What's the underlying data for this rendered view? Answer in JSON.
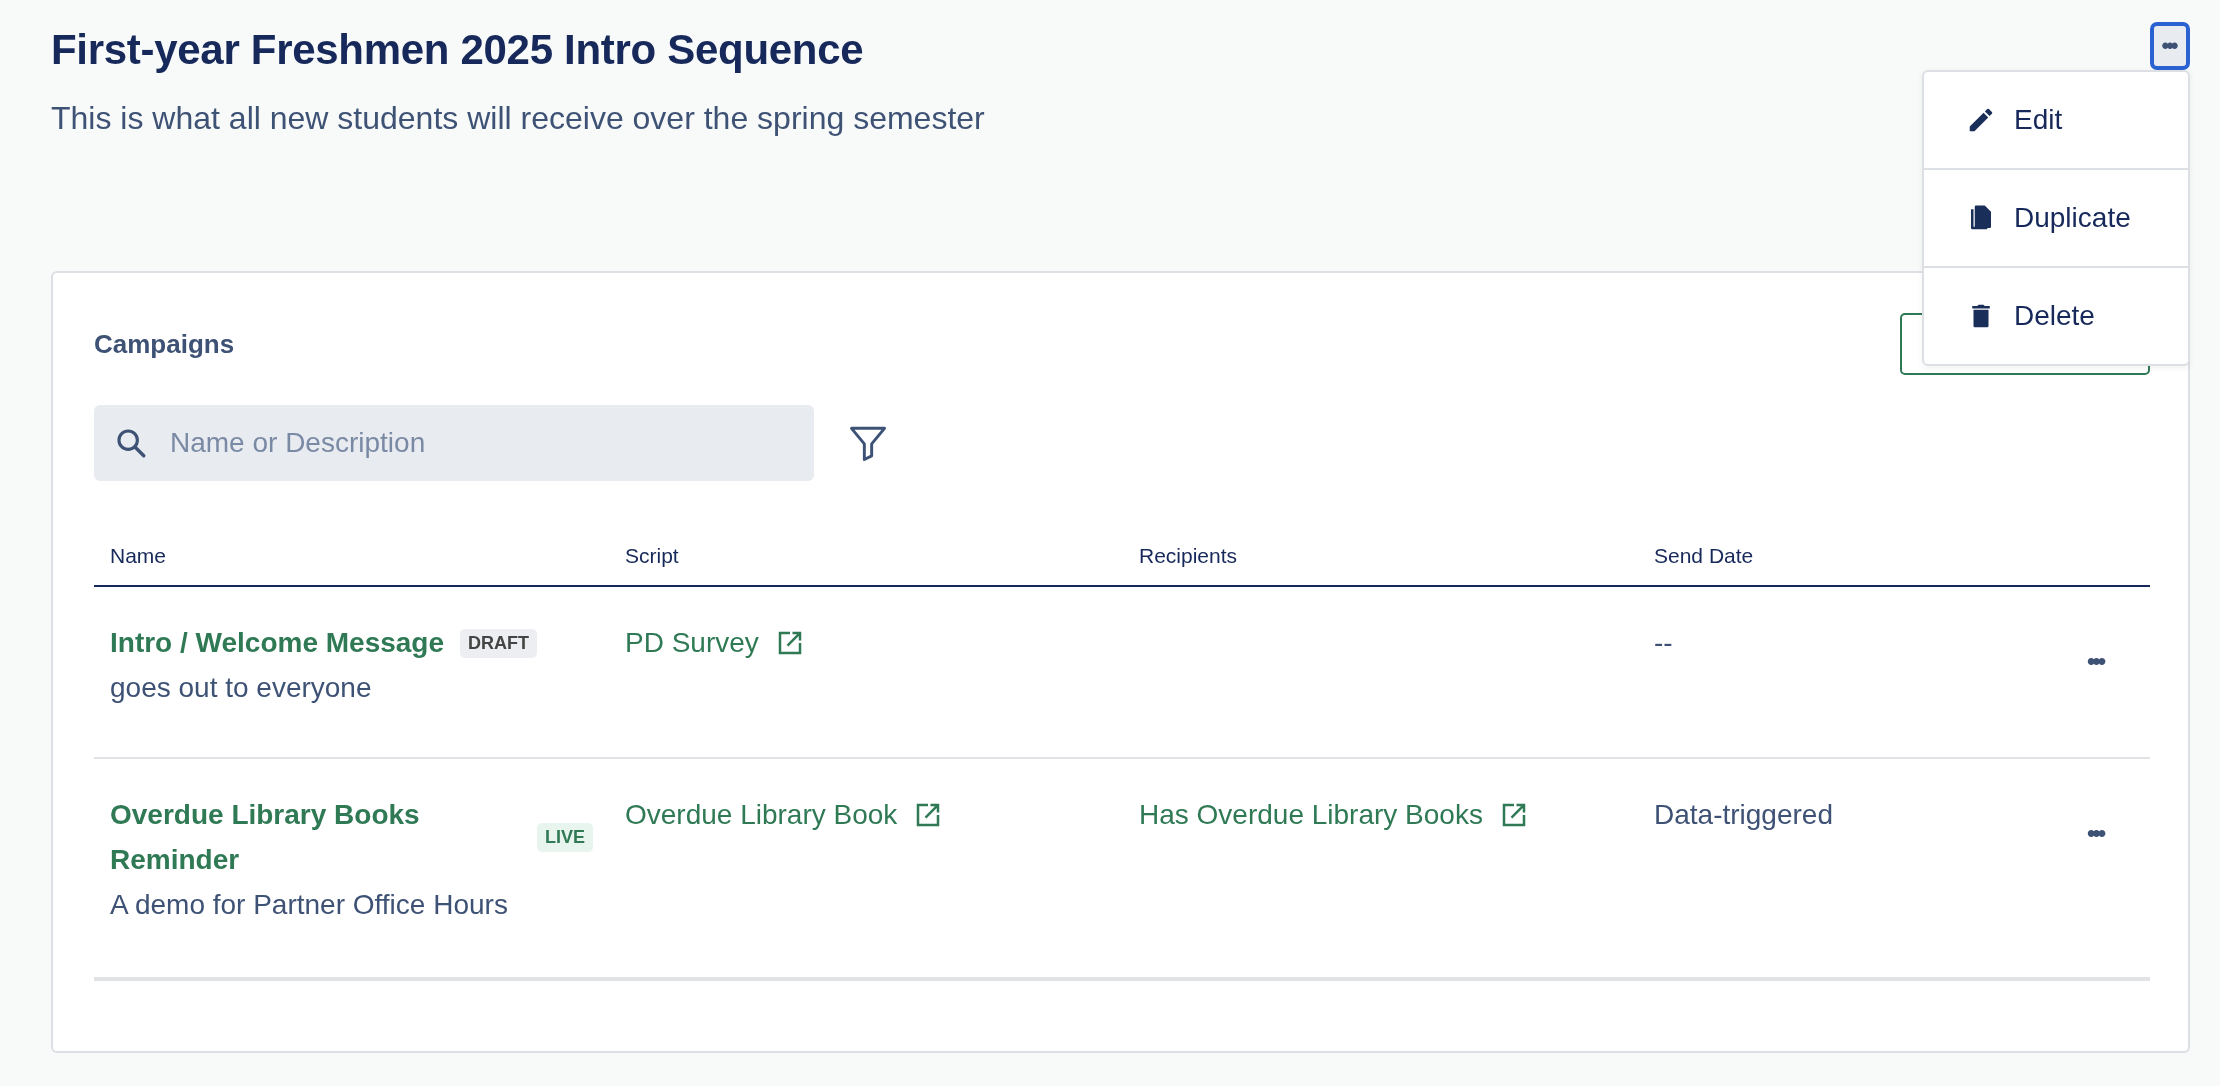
{
  "page": {
    "title": "First-year Freshmen 2025 Intro Sequence",
    "subtitle": "This is what all new students will receive over the spring semester",
    "more_button": {
      "label": "•••",
      "focused": true
    }
  },
  "menu": {
    "items": [
      {
        "label": "Edit",
        "kind": "edit"
      },
      {
        "label": "Duplicate",
        "kind": "duplicate"
      },
      {
        "label": "Delete",
        "kind": "delete"
      }
    ]
  },
  "campaigns": {
    "heading": "Campaigns",
    "search": {
      "placeholder": "Name or Description"
    },
    "table": {
      "columns": [
        "Name",
        "Script",
        "Recipients",
        "Send Date"
      ],
      "rows": [
        {
          "name": "Intro / Welcome Message",
          "status": {
            "label": "DRAFT",
            "kind": "draft"
          },
          "description": "goes out to everyone",
          "script": "PD Survey",
          "send_date": "--",
          "actions": "•••"
        },
        {
          "name": "Overdue Library Books Reminder",
          "status": {
            "label": "LIVE",
            "kind": "live"
          },
          "description": "A demo for Partner Office Hours",
          "script": "Overdue Library Book",
          "recipients": "Has Overdue Library Books",
          "send_date": "Data-triggered",
          "actions": "•••"
        }
      ]
    }
  }
}
